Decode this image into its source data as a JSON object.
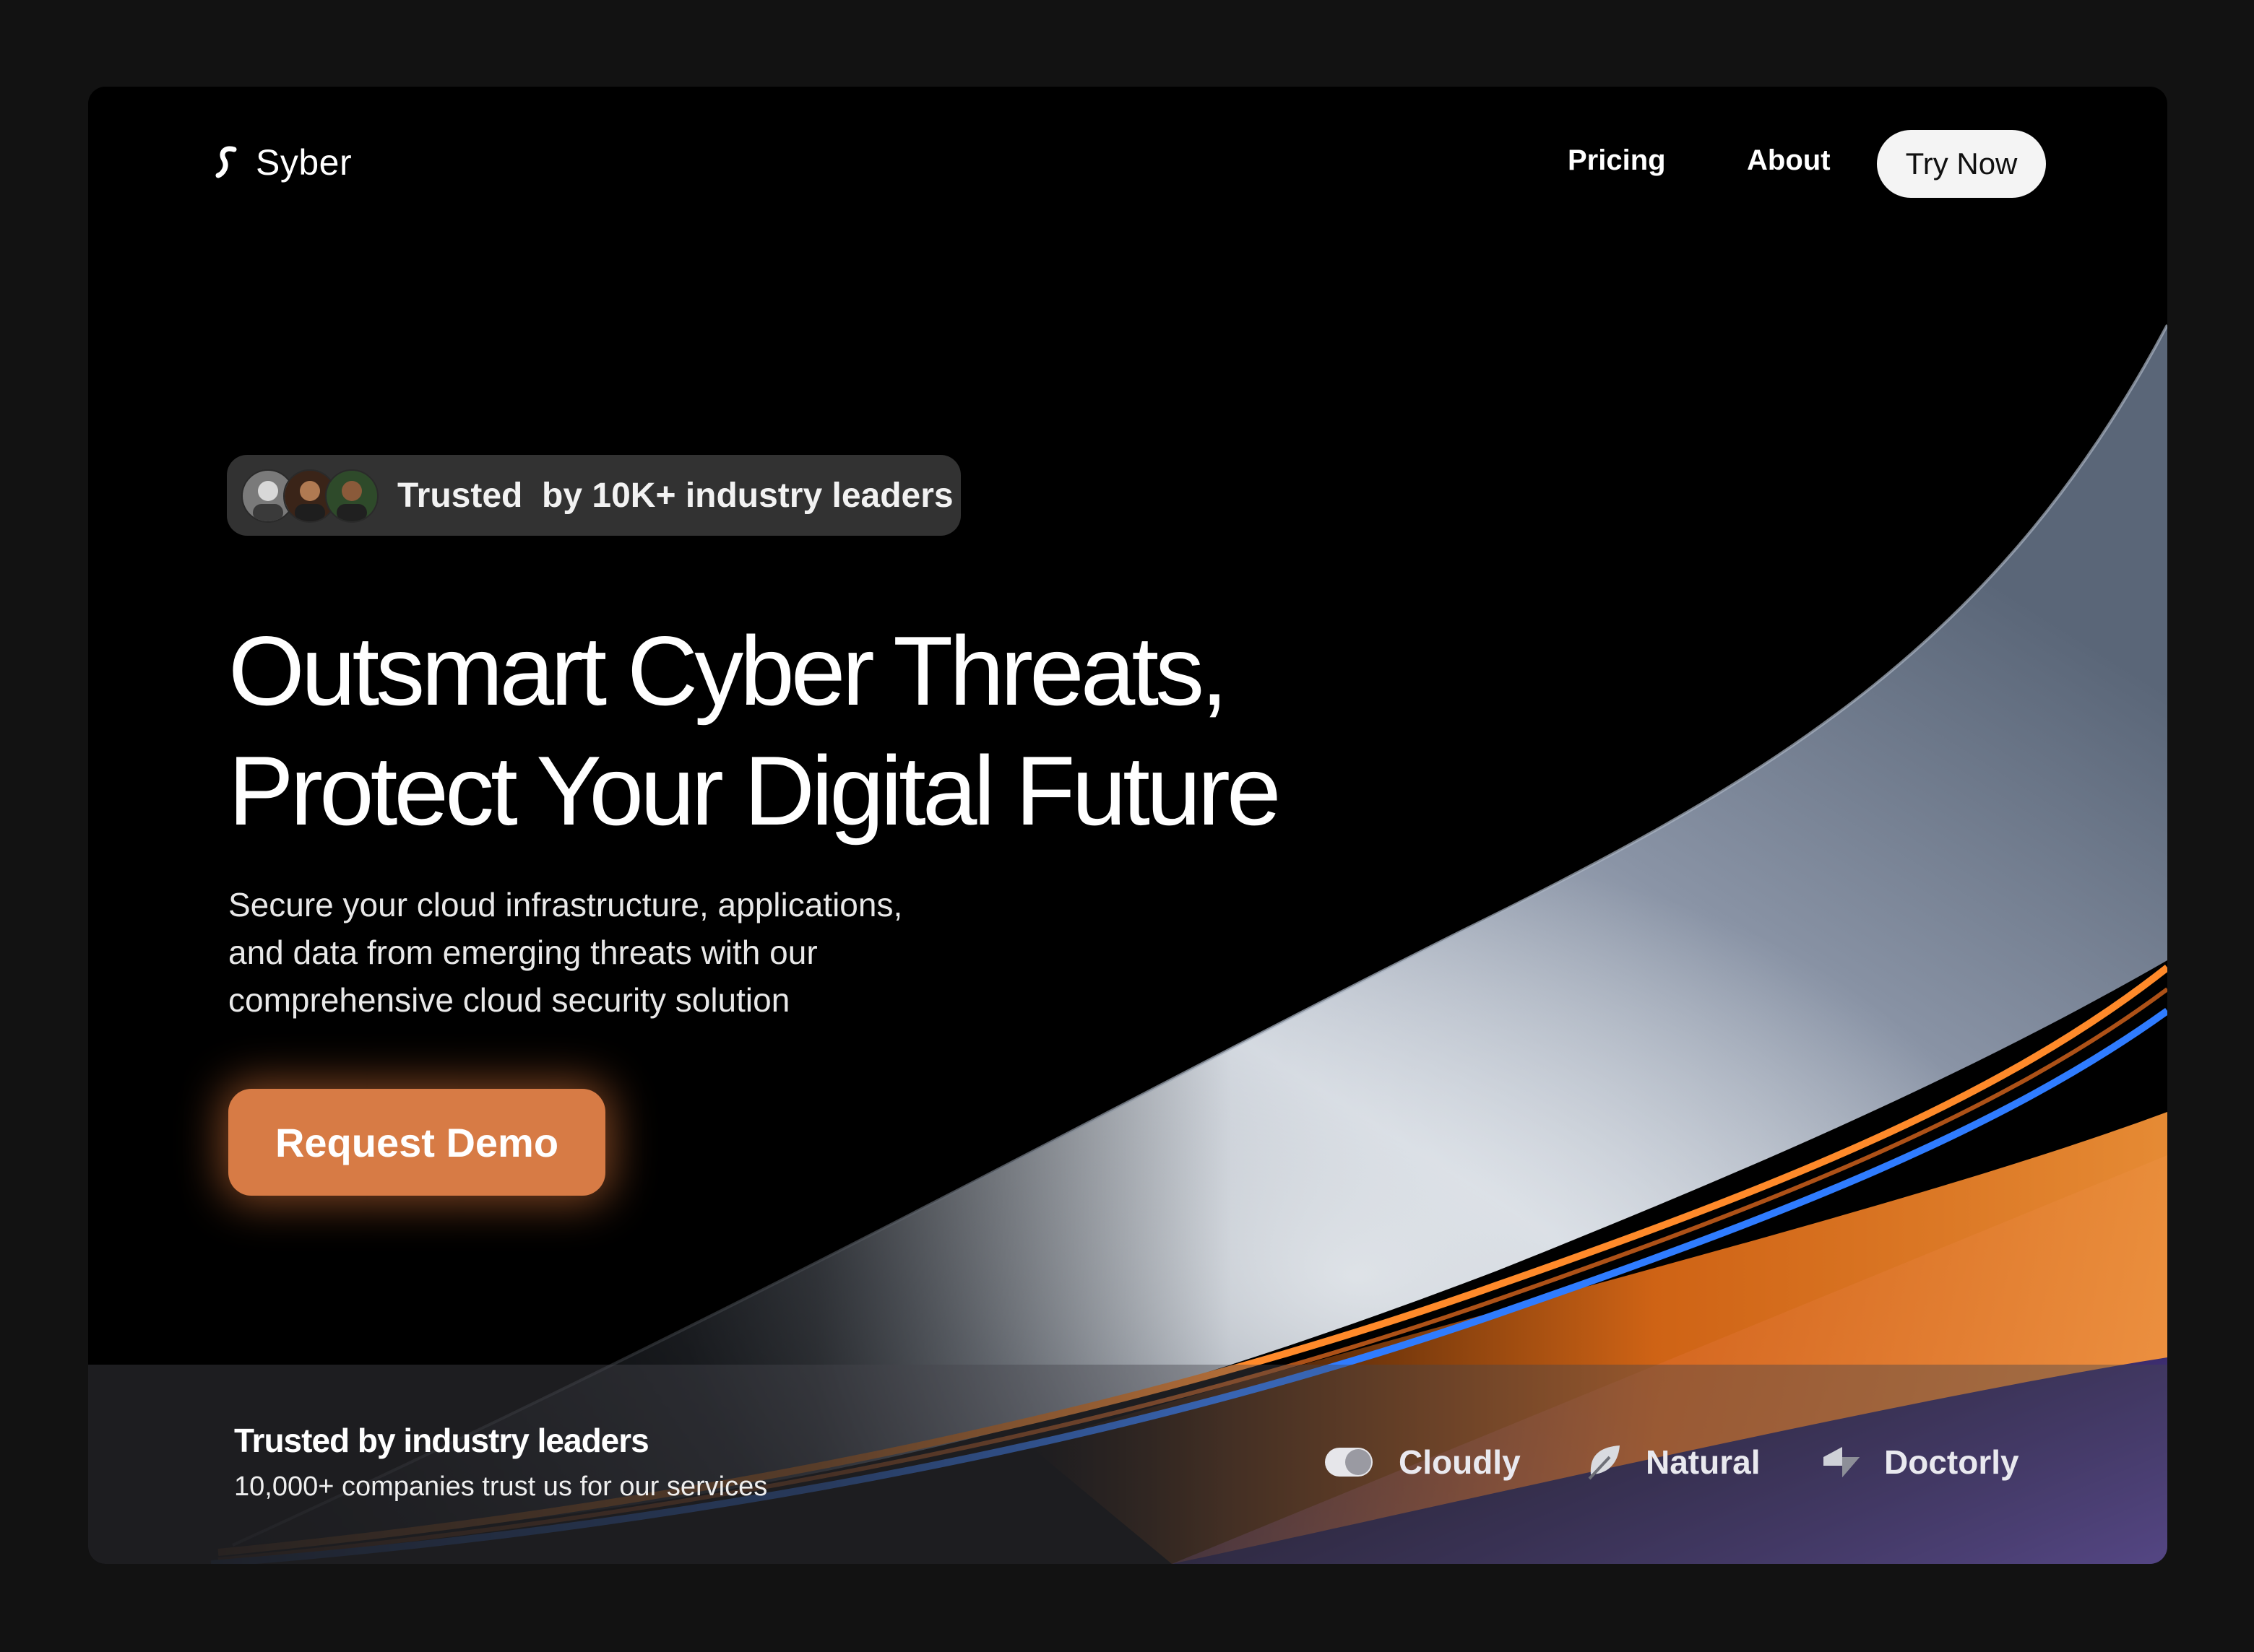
{
  "header": {
    "brand": "Syber",
    "nav": [
      {
        "label": "Pricing"
      },
      {
        "label": "About"
      }
    ],
    "cta_label": "Try Now"
  },
  "hero": {
    "trust_badge": "Trusted  by 10K+ industry leaders",
    "headline_line1": "Outsmart Cyber Threats,",
    "headline_line2": "Protect Your Digital Future",
    "subtext_line1": "Secure your cloud infrastructure, applications,",
    "subtext_line2": "and data from emerging threats with our",
    "subtext_line3": "comprehensive cloud security solution",
    "demo_label": "Request Demo"
  },
  "footer_strip": {
    "title": "Trusted by industry leaders",
    "subtitle": "10,000+ companies trust us for our services",
    "brands": [
      {
        "name": "Cloudly",
        "icon": "toggle-icon"
      },
      {
        "name": "Natural",
        "icon": "leaf-icon"
      },
      {
        "name": "Doctorly",
        "icon": "arrow-logo-icon"
      }
    ]
  },
  "colors": {
    "page_bg": "#121212",
    "frame_bg": "#000000",
    "accent": "#d77b45",
    "cta_bg": "#f4f4f4",
    "ribbon_orange": "#ff8a2a",
    "ribbon_blue": "#2f7cff",
    "strip_purple": "#5b3fa0"
  }
}
